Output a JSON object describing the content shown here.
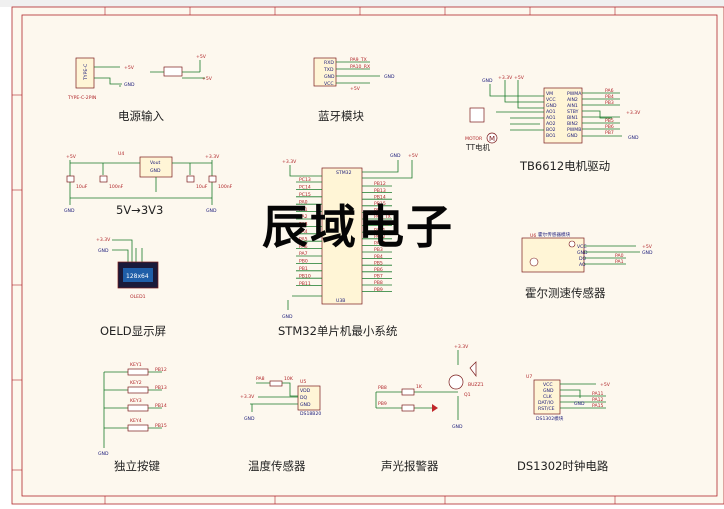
{
  "overlay_title": "辰域电子",
  "sections": {
    "power_input": "电源输入",
    "bluetooth": "蓝牙模块",
    "motor_driver": "TB6612电机驱动",
    "regulator": "5V→3V3",
    "oled": "OELD显示屏",
    "stm32": "STM32单片机最小系统",
    "hall": "霍尔测速传感器",
    "buttons": "独立按键",
    "temperature": "温度传感器",
    "alarm": "声光报警器",
    "clock": "DS1302时钟电路"
  },
  "parts": {
    "typec_label": "TYPE-C",
    "typec_ref": "TYPE-C-2PIN",
    "bt_pins": [
      "RXD",
      "TXD",
      "GND",
      "VCC"
    ],
    "bt_nets": [
      "PA9_TX",
      "PA10_RX",
      "GND",
      "+5V"
    ],
    "motor_name": "MOTOR",
    "motor_caption": "TT电机",
    "motor_symbol": "M",
    "tb_left_pins": [
      "VM",
      "VCC",
      "GND",
      "AO1",
      "AO1",
      "AO2",
      "BO2",
      "BO1",
      "BO1",
      "GND"
    ],
    "tb_right_pins": [
      "PWMA",
      "AIN2",
      "AIN1",
      "STBY",
      "BIN1",
      "BIN2",
      "PWMB",
      "GND"
    ],
    "tb_nets": [
      "PA6",
      "PB4",
      "PB3",
      "PB5",
      "PB6",
      "PB7"
    ],
    "reg_ref": "U4",
    "reg_pins": [
      "Vout",
      "GND",
      "Vin"
    ],
    "cap_vals": [
      "10uF",
      "100nF",
      "10uF",
      "100nF"
    ],
    "oled_ref": "OLED1",
    "oled_screen": "128x64",
    "mcu_ref": "U3B",
    "mcu_top": "STM32",
    "mcu_left_nets": [
      "PC13",
      "PC14",
      "PC15",
      "PA0",
      "PA1",
      "PA2",
      "PA3",
      "PA4",
      "PA5",
      "PA6",
      "PA7",
      "PB0",
      "PB1",
      "PB10",
      "PB11"
    ],
    "mcu_right_nets": [
      "PB12",
      "PB13",
      "PB14",
      "PB15",
      "PA8",
      "PA9_TX",
      "PA10_RX",
      "PA11",
      "PA12",
      "PA15",
      "PB3",
      "PB4",
      "PB5",
      "PB6",
      "PB7",
      "PB8",
      "PB9"
    ],
    "hall_ref": "U6",
    "hall_name": "霍尔传感器模块",
    "hall_pins": [
      "VCC",
      "GND",
      "DO",
      "AO"
    ],
    "hall_nets": [
      "+5V",
      "GND",
      "PA0",
      "PA1"
    ],
    "key_refs": [
      "KEY1",
      "KEY2",
      "KEY3",
      "KEY4"
    ],
    "key_nets": [
      "PB12",
      "PB13",
      "PB14",
      "PB15"
    ],
    "temp_ref": "U5",
    "temp_part": "DS18B20",
    "temp_pins": [
      "VDD",
      "DQ",
      "GND"
    ],
    "temp_res": "10K",
    "temp_net": "PA8",
    "alarm_nets": [
      "PB8",
      "PB9"
    ],
    "alarm_buzzer": "BUZZ1",
    "alarm_transistor": "Q1",
    "alarm_res": "1K",
    "rtc_ref": "U7",
    "rtc_part": "DS1302模块",
    "rtc_pins": [
      "VCC",
      "GND",
      "CLK",
      "DAT/IO",
      "RST/CE"
    ],
    "rtc_nets": [
      "+5V",
      "GND",
      "PA11",
      "PA12",
      "PA15"
    ],
    "vcc_3v3": "+3.3V",
    "vcc_5v": "+5V",
    "gnd": "GND"
  },
  "colors": {
    "wire": "#1a7a2a",
    "border": "#b0262a",
    "component": "#7a1a1a",
    "background": "#fdf8ee"
  }
}
